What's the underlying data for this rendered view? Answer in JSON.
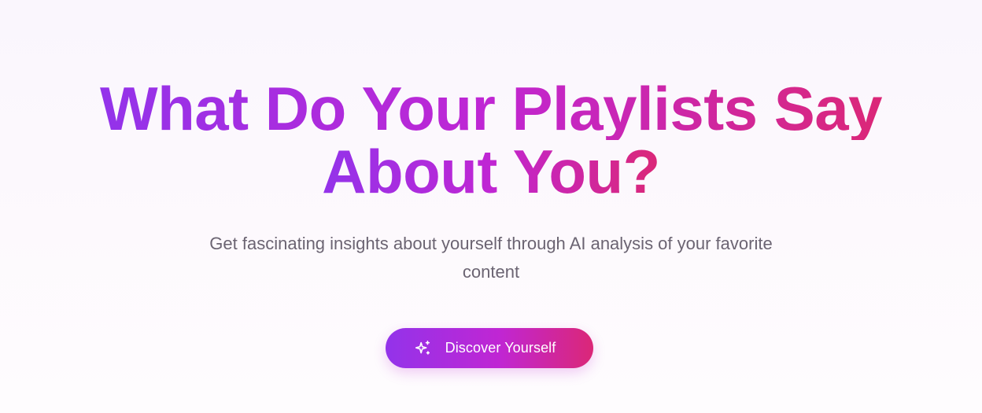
{
  "hero": {
    "headline_line1": "What Do Your Playlists Say",
    "headline_line2": "About You?",
    "subtitle": "Get fascinating insights about yourself through AI analysis of your favorite content",
    "cta_label": "Discover Yourself",
    "cta_icon": "sparkles-icon"
  },
  "colors": {
    "gradient_start": "#9333ea",
    "gradient_mid": "#c026d3",
    "gradient_end": "#db2777",
    "subtitle_text": "#6b6472",
    "background": "#faf6fd"
  }
}
